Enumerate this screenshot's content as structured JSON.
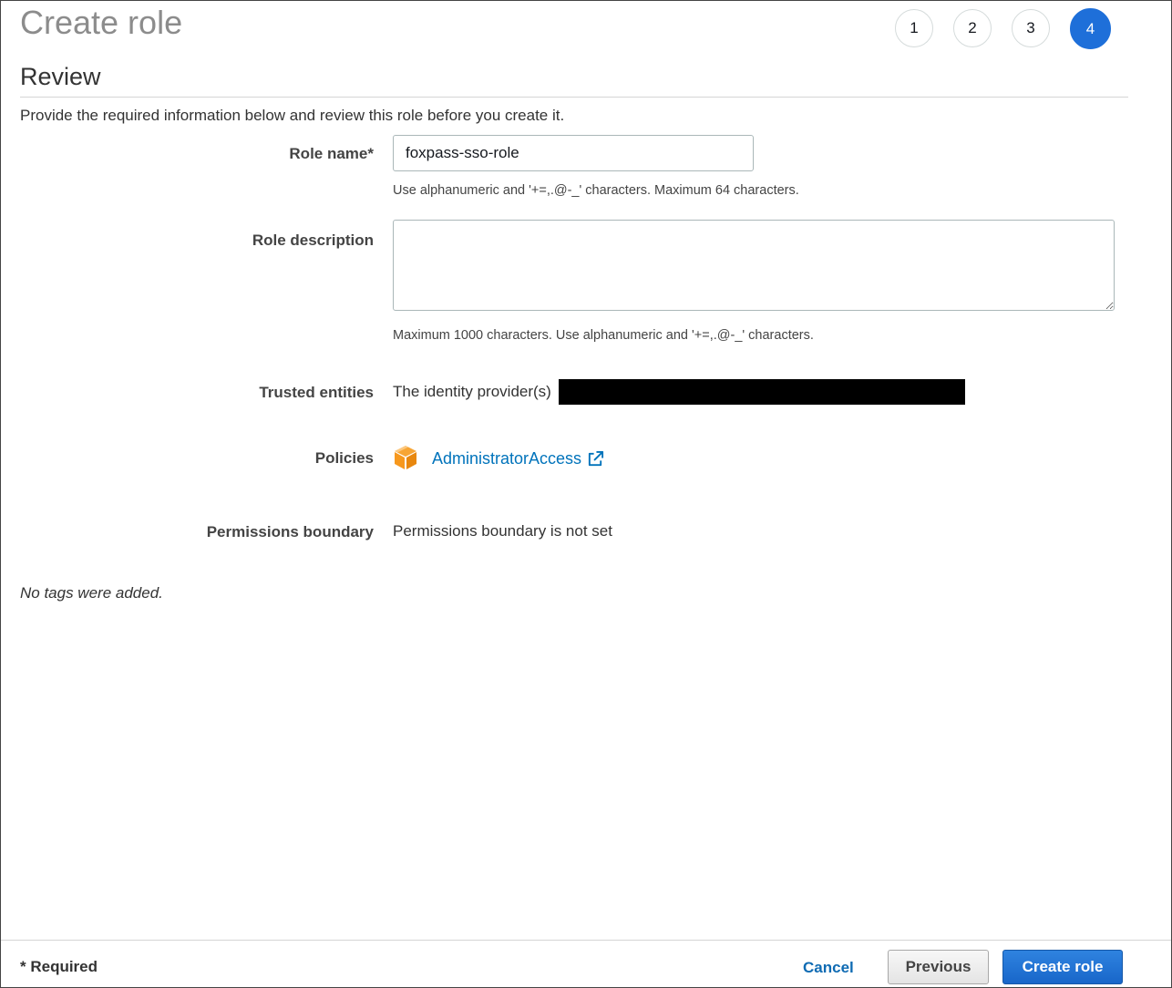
{
  "header": {
    "title": "Create role",
    "steps": [
      "1",
      "2",
      "3",
      "4"
    ],
    "active_step": "4"
  },
  "review": {
    "section_title": "Review",
    "intro": "Provide the required information below and review this role before you create it."
  },
  "form": {
    "role_name": {
      "label": "Role name*",
      "value": "foxpass-sso-role",
      "hint": "Use alphanumeric and '+=,.@-_' characters. Maximum 64 characters."
    },
    "role_description": {
      "label": "Role description",
      "value": "",
      "hint": "Maximum 1000 characters. Use alphanumeric and '+=,.@-_' characters."
    },
    "trusted_entities": {
      "label": "Trusted entities",
      "value": "The identity provider(s)"
    },
    "policies": {
      "label": "Policies",
      "items": [
        {
          "name": "AdministratorAccess",
          "icon": "policy-cube-icon"
        }
      ]
    },
    "permissions_boundary": {
      "label": "Permissions boundary",
      "value": "Permissions boundary is not set"
    }
  },
  "tags": {
    "empty_text": "No tags were added."
  },
  "footer": {
    "required_note": "* Required",
    "cancel_label": "Cancel",
    "previous_label": "Previous",
    "create_label": "Create role"
  },
  "colors": {
    "accent": "#1e6fd9",
    "link": "#0073bb",
    "policy_icon": "#f7981d"
  }
}
